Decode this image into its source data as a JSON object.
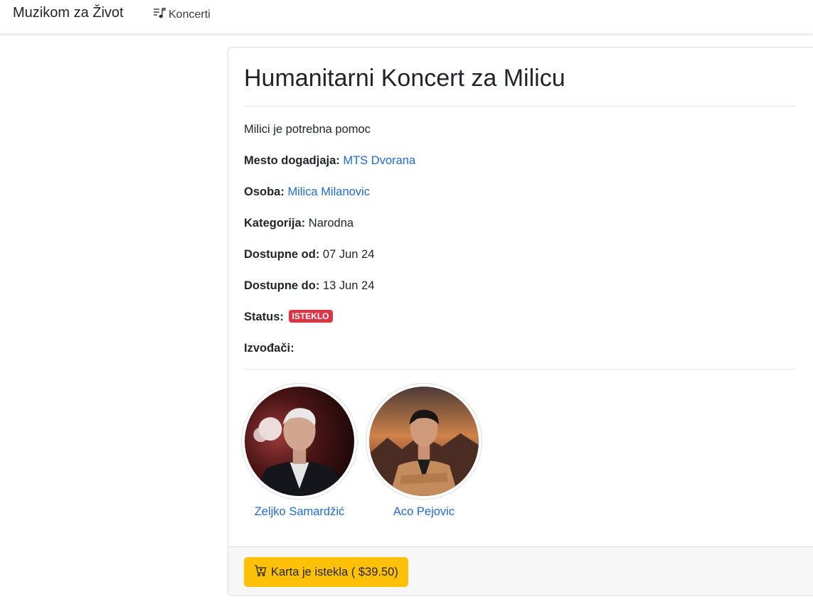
{
  "navbar": {
    "brand": "Muzikom za Život",
    "concerts_label": "Koncerti",
    "concerts_icon": "music-note-list-icon"
  },
  "concert": {
    "title": "Humanitarni Koncert za Milicu",
    "description": "Milici je potrebna pomoc",
    "venue_label": "Mesto dogadjaja:",
    "venue": "MTS Dvorana",
    "person_label": "Osoba:",
    "person": "Milica Milanovic",
    "category_label": "Kategorija:",
    "category": "Narodna",
    "available_from_label": "Dostupne od:",
    "available_from": "07 Jun 24",
    "available_to_label": "Dostupne do:",
    "available_to": "13 Jun 24",
    "status_label": "Status:",
    "status": "ISTEKLO",
    "performers_label": "Izvođači:"
  },
  "performers": [
    {
      "name": "Zeljko Samardžić"
    },
    {
      "name": "Aco Pejovic"
    }
  ],
  "footer": {
    "button_label": "Karta je istekla ( $39.50)",
    "button_icon": "cart-icon"
  },
  "colors": {
    "link": "#1f6bd6",
    "badge": "#dc3545",
    "button": "#ffc107"
  }
}
